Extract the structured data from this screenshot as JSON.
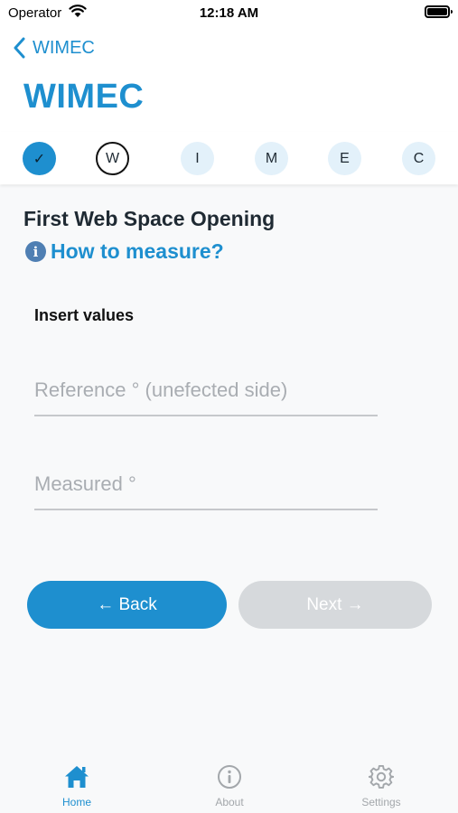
{
  "status_bar": {
    "carrier": "Operator",
    "time": "12:18 AM"
  },
  "nav": {
    "back_label": "WIMEC",
    "title": "WIMEC"
  },
  "stepper": {
    "steps": [
      {
        "label": "✓",
        "state": "done"
      },
      {
        "label": "W",
        "state": "active"
      },
      {
        "label": "I",
        "state": "pending"
      },
      {
        "label": "M",
        "state": "pending"
      },
      {
        "label": "E",
        "state": "pending"
      },
      {
        "label": "C",
        "state": "pending"
      }
    ]
  },
  "content": {
    "section_title": "First Web Space Opening",
    "info_icon": "i",
    "how_to_link": "How to measure?",
    "insert_label": "Insert values",
    "reference_placeholder": "Reference ° (unefected side)",
    "measured_placeholder": "Measured °",
    "back_button": "← Back",
    "next_button": "Next →"
  },
  "tabbar": {
    "home": "Home",
    "about": "About",
    "settings": "Settings"
  },
  "colors": {
    "accent": "#1e8fcf",
    "disabled": "#d6d9dc",
    "step_pending": "#e3f1fa"
  },
  "icons": {
    "back": "chevron-left-icon",
    "home": "home-icon",
    "about": "info-circle-icon",
    "settings": "gear-icon"
  }
}
